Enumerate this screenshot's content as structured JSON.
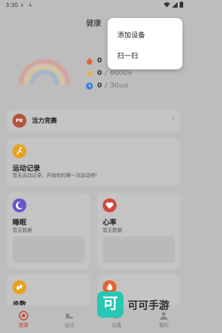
{
  "status_bar": {
    "time": "3:30",
    "download_icons": [
      "download-icon",
      "download-icon"
    ],
    "system_icons": [
      "wifi-icon",
      "signal-icon",
      "battery-icon"
    ]
  },
  "app_bar": {
    "title": "健康",
    "menu_icon": "add-icon"
  },
  "popup_menu": {
    "items": [
      "添加设备",
      "扫一扫"
    ]
  },
  "summary": {
    "calories": {
      "value": "0",
      "goal": "",
      "unit": "",
      "icon": "flame-icon",
      "color": "#e8622c"
    },
    "steps": {
      "value": "0",
      "goal": "6000",
      "unit": "步",
      "icon": "footprint-icon",
      "color": "#f0b32c"
    },
    "minutes": {
      "value": "0",
      "goal": "30",
      "unit": "分钟",
      "icon": "clock-icon",
      "color": "#3b7fd6"
    },
    "separator": "/"
  },
  "pk_card": {
    "badge": "PK",
    "label": "活力竞赛",
    "chevron": "›"
  },
  "sport_card": {
    "title": "运动记录",
    "subtitle": "暂无运动记录，开始你的第一次运动吧!",
    "icon": "run-icon",
    "icon_color": "#e9a21d"
  },
  "sleep_card": {
    "title": "睡眠",
    "subtitle": "暂无数据",
    "icon": "moon-icon",
    "icon_color": "#6b57c9"
  },
  "heart_card": {
    "title": "心率",
    "subtitle": "暂无数据",
    "icon": "heart-icon",
    "icon_color": "#d4443a"
  },
  "steps_card": {
    "title": "步数",
    "icon": "footprint-icon",
    "icon_color": "#e9a21d"
  },
  "bottom_nav": {
    "items": [
      "健康",
      "运动",
      "设备",
      "我的"
    ],
    "active": 0,
    "active_color": "#c8472b"
  },
  "watermark": {
    "logo_char": "可",
    "text": "可可手游"
  }
}
